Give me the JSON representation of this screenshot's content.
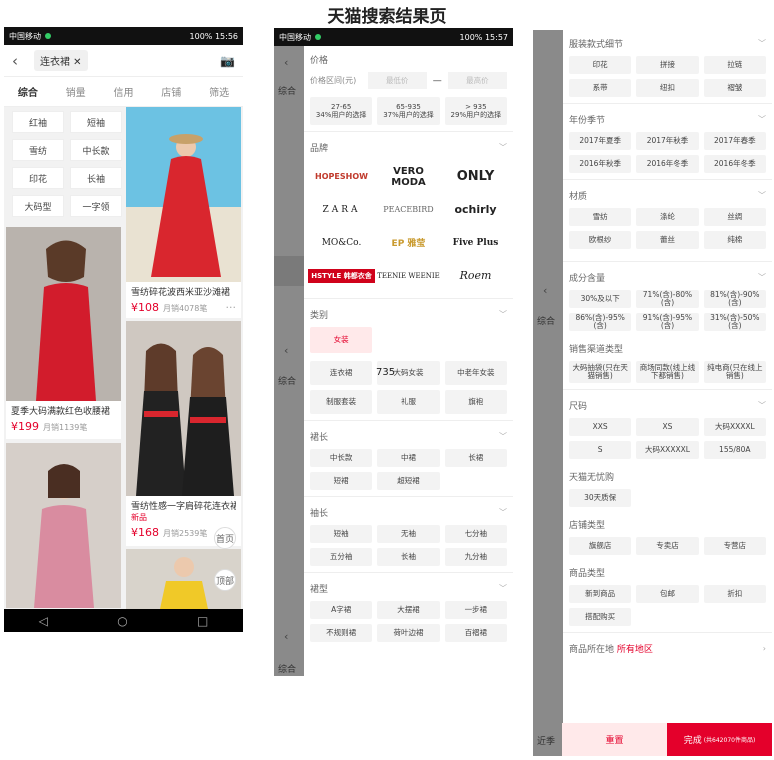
{
  "page_title": "天猫搜索结果页",
  "status": {
    "left": "中国移动",
    "right1": "100%  15:56",
    "right2": "100%  15:57"
  },
  "search": {
    "query": "连衣裙"
  },
  "sorts": [
    "综合",
    "销量",
    "信用",
    "店铺",
    "筛选"
  ],
  "tags": [
    "红袖",
    "短袖",
    "雪纺",
    "中长款",
    "印花",
    "长袖",
    "大码型",
    "一字领"
  ],
  "products": [
    {
      "name": "夏季大码满款红色收腰裙",
      "price": "¥199",
      "sales": "月销1139笔"
    },
    {
      "name": "雪纺碎花波西米亚沙滩裙",
      "price": "¥108",
      "sales": "月销4078笔"
    },
    {
      "name": "雪纺性感一字肩碎花连衣裙",
      "badge": "新品",
      "price": "¥168",
      "sales": "月销2539笔"
    }
  ],
  "fab_labels": {
    "home": "首页",
    "top": "顶部"
  },
  "filter1": {
    "price_label": "价格",
    "price_range_label": "价格区间(元)",
    "min_placeholder": "最低价",
    "max_placeholder": "最高价",
    "price_ranges": [
      "27-65\n34%用户的选择",
      "65-935\n37%用户的选择",
      "> 935\n29%用户的选择"
    ],
    "brand_label": "品牌",
    "brands": [
      "HOPESHOW",
      "VERO MODA",
      "ONLY",
      "ZARA",
      "PEACEBIRD",
      "ochirly",
      "MO&Co.",
      "EP 雅莹",
      "Five Plus",
      "HSTYLE 韩都衣舍",
      "TEENIE WEENIE",
      "Roem"
    ],
    "category_label": "类别",
    "category_sel": "女装",
    "categories": [
      "连衣裙",
      "大码女装",
      "中老年女装",
      "制服套装",
      "礼服",
      "旗袍"
    ],
    "length_label": "裙长",
    "lengths": [
      "中长款",
      "中裙",
      "长裙",
      "短裙",
      "超短裙"
    ],
    "sleeve_label": "袖长",
    "sleeves": [
      "短袖",
      "无袖",
      "七分袖",
      "五分袖",
      "长袖",
      "九分袖"
    ],
    "shape_label": "裙型",
    "shapes": [
      "A字裙",
      "大摆裙",
      "一步裙",
      "不规则裙",
      "荷叶边裙",
      "百褶裙"
    ],
    "stray_number": "735"
  },
  "filter2": {
    "detail_label": "服装款式细节",
    "details": [
      "印花",
      "拼接",
      "拉链",
      "系带",
      "纽扣",
      "褶皱"
    ],
    "season_label": "年份季节",
    "seasons": [
      "2017年夏季",
      "2017年秋季",
      "2017年春季",
      "2016年秋季",
      "2016年冬季",
      "2016年冬季"
    ],
    "material_label": "材质",
    "materials": [
      "雪纺",
      "涤纶",
      "丝绸",
      "欧根纱",
      "蕾丝",
      "纯棉"
    ],
    "content_label": "成分含量",
    "contents": [
      "30%及以下",
      "71%(含)-80%(含)",
      "81%(含)-90%(含)",
      "86%(含)-95%(含)",
      "91%(含)-95%(含)",
      "31%(含)-50%(含)"
    ],
    "channel_label": "销售渠道类型",
    "channels": [
      "大码抽袋(只在天猫销售)",
      "商场同款(线上线下都销售)",
      "纯电商(只在线上销售)"
    ],
    "size_label": "尺码",
    "sizes": [
      "XXS",
      "XS",
      "大码XXXXL",
      "S",
      "大码XXXXXL",
      "155/80A"
    ],
    "tmall_label": "天猫无忧购",
    "tmall_opt": "30天质保",
    "store_label": "店铺类型",
    "stores": [
      "旗舰店",
      "专卖店",
      "专营店"
    ],
    "goods_label": "商品类型",
    "goods": [
      "新到商品",
      "包邮",
      "折扣",
      "搭配购买"
    ],
    "location_label": "商品所在地",
    "location_value": "所有地区",
    "reset": "重置",
    "done": "完成",
    "done_sub": "(共642070件商品)"
  },
  "colors": {
    "accent": "#e4002b",
    "selected_bg": "#ffe9ea"
  }
}
